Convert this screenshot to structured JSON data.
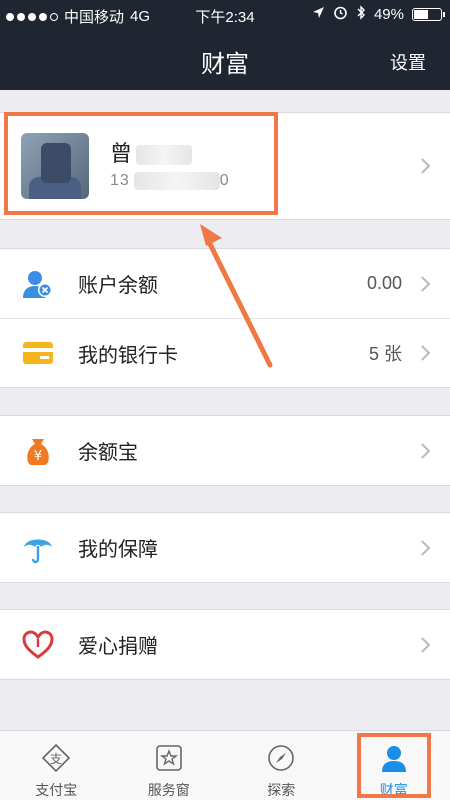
{
  "status_bar": {
    "carrier": "中国移动",
    "network": "4G",
    "time": "下午2:34",
    "battery": "49%",
    "signal_dots": 4,
    "signal_total": 5
  },
  "nav": {
    "title": "财富",
    "settings_label": "设置"
  },
  "profile": {
    "name_visible": "曾",
    "phone_visible_start": "13",
    "phone_visible_end": "0"
  },
  "account_group": {
    "items": [
      {
        "label": "账户余额",
        "value": "0.00",
        "icon": "user-balance-icon"
      },
      {
        "label": "我的银行卡",
        "value": "5 张",
        "icon": "bank-card-icon"
      }
    ]
  },
  "yuebao": {
    "label": "余额宝",
    "icon": "money-bag-icon"
  },
  "insurance": {
    "label": "我的保障",
    "icon": "umbrella-icon"
  },
  "charity": {
    "label": "爱心捐赠",
    "icon": "heart-icon"
  },
  "tabbar": {
    "items": [
      {
        "label": "支付宝",
        "icon": "alipay-icon"
      },
      {
        "label": "服务窗",
        "icon": "star-window-icon"
      },
      {
        "label": "探索",
        "icon": "compass-icon"
      },
      {
        "label": "财富",
        "icon": "wealth-user-icon"
      }
    ]
  },
  "colors": {
    "accent": "#1b8fe8",
    "annotation": "#f07848",
    "nav_bg": "#1f2631"
  }
}
